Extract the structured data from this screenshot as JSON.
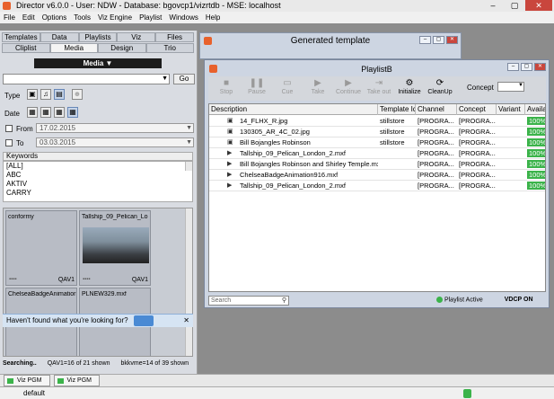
{
  "window": {
    "title": "Director v6.0.0 - User: NDW - Database: bgovcp1/vizrtdb - MSE: localhost"
  },
  "menu": [
    "File",
    "Edit",
    "Options",
    "Tools",
    "Viz Engine",
    "Playlist",
    "Windows",
    "Help"
  ],
  "left": {
    "tabs_row1": [
      "Templates",
      "Data",
      "Playlists",
      "Viz",
      "Files"
    ],
    "tabs_row2": [
      "Cliplist",
      "Media",
      "Design",
      "Trio"
    ],
    "media_header": "Media",
    "go_label": "Go",
    "type_label": "Type",
    "date_label": "Date",
    "from_label": "From",
    "from_value": "17.02.2015",
    "to_label": "To",
    "to_value": "03.03.2015",
    "keywords_label": "Keywords",
    "keywords": [
      "[ALL]",
      "ABC",
      "AKTIV",
      "CARRY"
    ],
    "thumbs": [
      {
        "name": "conformy",
        "tag": "QAV1"
      },
      {
        "name": "Tallship_09_Pelican_Lo",
        "tag": "QAV1"
      },
      {
        "name": "ChelseaBadgeAnimatior",
        "tag": ""
      },
      {
        "name": "PLNEW329.mxf",
        "tag": ""
      }
    ],
    "banner": "Haven't found what you're looking for?",
    "status": {
      "searching": "Searching..",
      "qav": "QAV1=16 of 21 shown",
      "bkkvme": "bkkvme=14 of 39 shown"
    }
  },
  "generated": {
    "title": "Generated template"
  },
  "playlist": {
    "title": "PlaylistB",
    "tools": [
      {
        "label": "Stop",
        "glyph": "■",
        "on": false
      },
      {
        "label": "Pause",
        "glyph": "❚❚",
        "on": false
      },
      {
        "label": "Cue",
        "glyph": "▭",
        "on": false
      },
      {
        "label": "Take",
        "glyph": "▶",
        "on": false
      },
      {
        "label": "Continue",
        "glyph": "▶",
        "on": false
      },
      {
        "label": "Take out",
        "glyph": "⇥",
        "on": false
      },
      {
        "label": "Initialize",
        "glyph": "⚙",
        "on": true
      },
      {
        "label": "CleanUp",
        "glyph": "⟳",
        "on": true
      }
    ],
    "concept_label": "Concept",
    "columns": [
      "Description",
      "Template Id",
      "Channel",
      "Concept",
      "Variant",
      "Availa..."
    ],
    "rows": [
      {
        "icon": "image",
        "desc": "14_FLHX_R.jpg",
        "tpl": "stillstore",
        "ch": "[PROGRA...",
        "con": "[PROGRA...",
        "var": "",
        "avail": "100%"
      },
      {
        "icon": "image",
        "desc": "130305_AR_4C_02.jpg",
        "tpl": "stillstore",
        "ch": "[PROGRA...",
        "con": "[PROGRA...",
        "var": "",
        "avail": "100%"
      },
      {
        "icon": "image",
        "desc": "Bill Bojangles Robinson",
        "tpl": "stillstore",
        "ch": "[PROGRA...",
        "con": "[PROGRA...",
        "var": "",
        "avail": "100%"
      },
      {
        "icon": "video",
        "desc": "Tallship_09_Pelican_London_2.mxf",
        "tpl": "",
        "ch": "[PROGRA...",
        "con": "[PROGRA...",
        "var": "",
        "avail": "100%"
      },
      {
        "icon": "video",
        "desc": "Bill Bojangles Robinson and Shirley Temple.mxf",
        "tpl": "",
        "ch": "[PROGRA...",
        "con": "[PROGRA...",
        "var": "",
        "avail": "100%"
      },
      {
        "icon": "video",
        "desc": "ChelseaBadgeAnimation916.mxf",
        "tpl": "",
        "ch": "[PROGRA...",
        "con": "[PROGRA...",
        "var": "",
        "avail": "100%"
      },
      {
        "icon": "video",
        "desc": "Tallship_09_Pelican_London_2.mxf",
        "tpl": "",
        "ch": "[PROGRA...",
        "con": "[PROGRA...",
        "var": "",
        "avail": "100%"
      }
    ],
    "search_placeholder": "Search",
    "status_active": "Playlist Active",
    "vdcp": "VDCP ON"
  },
  "vizbar": [
    "Viz PGM",
    "Viz PGM"
  ],
  "statusbar": {
    "text": "default"
  }
}
